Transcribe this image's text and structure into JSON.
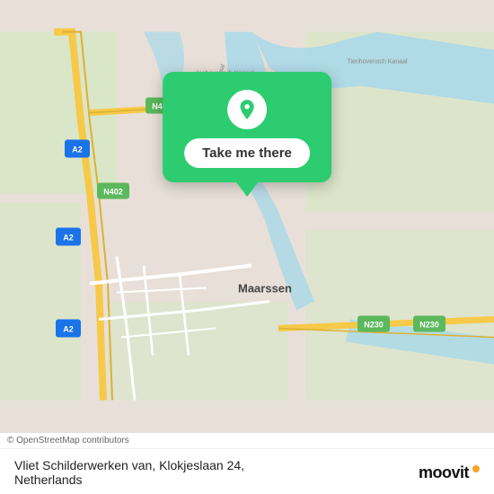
{
  "map": {
    "alt": "Map of Maarssen, Netherlands"
  },
  "tooltip": {
    "button_label": "Take me there"
  },
  "footer": {
    "copyright": "© OpenStreetMap contributors",
    "location_name": "Vliet Schilderwerken van, Klokjeslaan 24,",
    "location_country": "Netherlands",
    "logo_text": "moovit"
  },
  "colors": {
    "green": "#2ecc71",
    "road_major": "#f7c948",
    "road_minor": "#ffffff",
    "water": "#a8d8ea",
    "land": "#e8e0d8",
    "park": "#c8e6c9"
  }
}
